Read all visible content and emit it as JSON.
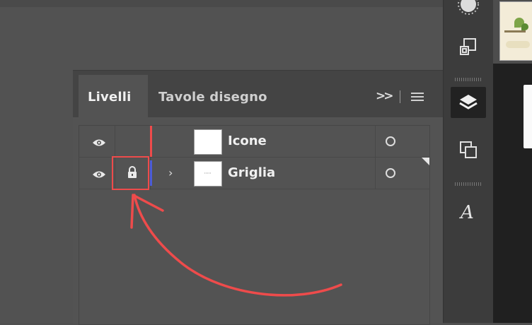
{
  "panel": {
    "tabs": [
      {
        "label": "Livelli",
        "active": true
      },
      {
        "label": "Tavole disegno",
        "active": false
      }
    ],
    "overflow_label": ">>",
    "layers": [
      {
        "name": "Icone",
        "visible": true,
        "locked": false,
        "expandable": false,
        "color": "#ee4b4b"
      },
      {
        "name": "Griglia",
        "visible": true,
        "locked": true,
        "expandable": true,
        "color": "#4d5bd6"
      }
    ]
  },
  "dock": {
    "icons": [
      "brightness-icon",
      "transform-icon",
      "layers-icon",
      "artboards-icon",
      "character-style-icon"
    ],
    "active_icon": "layers-icon"
  },
  "annotation": {
    "color": "#ee4b4b",
    "target": "lock-toggle"
  }
}
